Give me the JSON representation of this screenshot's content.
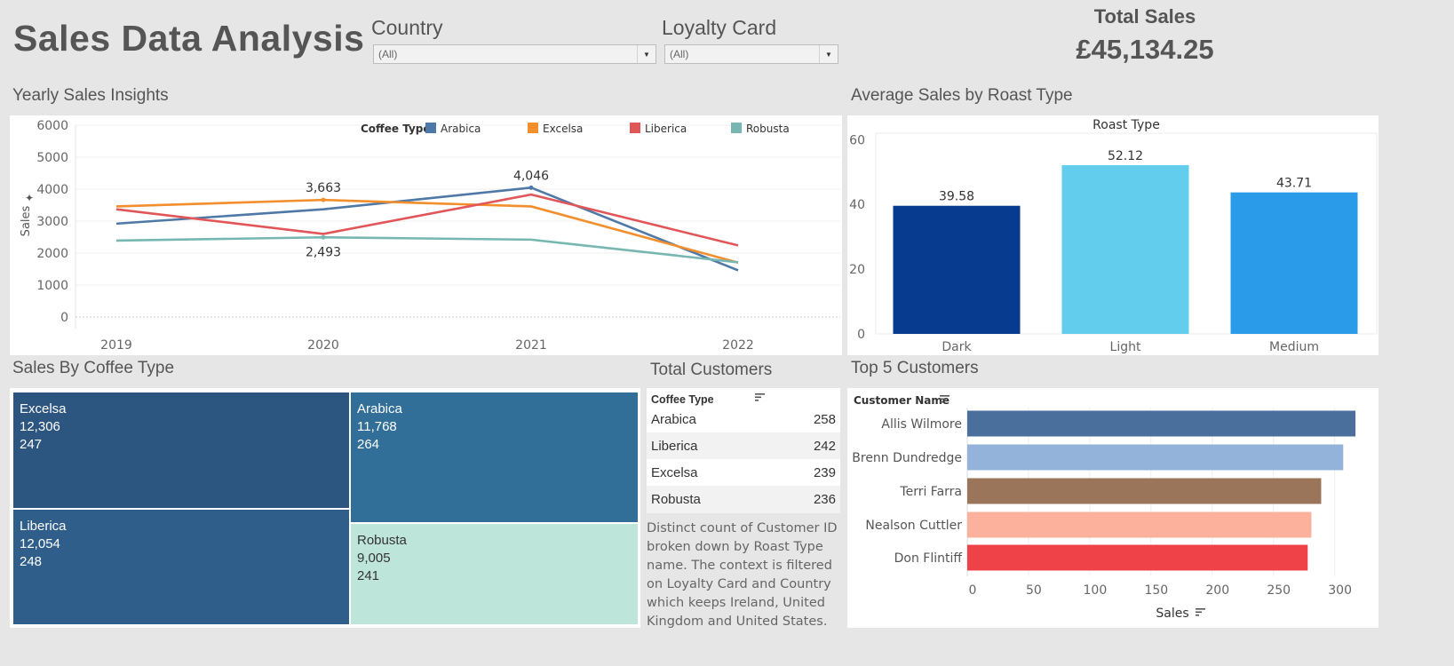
{
  "header": {
    "title": "Sales Data Analysis",
    "filters": [
      {
        "label": "Country",
        "value": "(All)"
      },
      {
        "label": "Loyalty Card",
        "value": "(All)"
      }
    ],
    "kpi": {
      "label": "Total Sales",
      "value": "£45,134.25"
    }
  },
  "sections": {
    "yearly": "Yearly Sales Insights",
    "roast": "Average Sales by Roast Type",
    "coffee": "Sales By Coffee Type",
    "customers": "Total Customers",
    "top5": "Top 5 Customers"
  },
  "colors": {
    "Arabica": "#4e79a7",
    "Excelsa": "#f28e2b",
    "Liberica": "#e15759",
    "Robusta": "#76b7b2"
  },
  "chart_data": [
    {
      "type": "line",
      "ylabel": "Sales",
      "legend_title": "Coffee Type",
      "x": [
        "2019",
        "2020",
        "2021",
        "2022"
      ],
      "ylim": [
        0,
        6000
      ],
      "yticks": [
        "0",
        "1000",
        "2000",
        "3000",
        "4000",
        "5000",
        "6000"
      ],
      "series": [
        {
          "name": "Arabica",
          "values": [
            2920,
            3370,
            4046,
            1460
          ]
        },
        {
          "name": "Excelsa",
          "values": [
            3460,
            3663,
            3460,
            1700
          ]
        },
        {
          "name": "Liberica",
          "values": [
            3370,
            2600,
            3830,
            2240
          ]
        },
        {
          "name": "Robusta",
          "values": [
            2390,
            2493,
            2420,
            1710
          ]
        }
      ],
      "annotations": [
        {
          "series": "Excelsa",
          "x": "2020",
          "text": "3,663"
        },
        {
          "series": "Robusta",
          "x": "2020",
          "text": "2,493"
        },
        {
          "series": "Arabica",
          "x": "2021",
          "text": "4,046"
        }
      ]
    },
    {
      "type": "bar",
      "title": "Roast Type",
      "categories": [
        "Dark",
        "Light",
        "Medium"
      ],
      "values": [
        39.58,
        52.12,
        43.71
      ],
      "labels": [
        "39.58",
        "52.12",
        "43.71"
      ],
      "colors": [
        "#063b8f",
        "#63cdee",
        "#2a9be9"
      ],
      "ylim": [
        0,
        62
      ],
      "yticks": [
        "0",
        "20",
        "40",
        "60"
      ]
    },
    {
      "type": "treemap",
      "cells": [
        {
          "name": "Excelsa",
          "sales": "12,306",
          "count": "247",
          "color": "#2c557f",
          "text": "#ffffff"
        },
        {
          "name": "Arabica",
          "sales": "11,768",
          "count": "264",
          "color": "#326f98",
          "text": "#ffffff"
        },
        {
          "name": "Liberica",
          "sales": "12,054",
          "count": "248",
          "color": "#2e5e89",
          "text": "#ffffff"
        },
        {
          "name": "Robusta",
          "sales": "9,005",
          "count": "241",
          "color": "#bee5da",
          "text": "#333333"
        }
      ]
    },
    {
      "type": "table",
      "header": "Coffee Type",
      "rows": [
        {
          "name": "Arabica",
          "value": "258"
        },
        {
          "name": "Liberica",
          "value": "242"
        },
        {
          "name": "Excelsa",
          "value": "239"
        },
        {
          "name": "Robusta",
          "value": "236"
        }
      ]
    },
    {
      "type": "bar",
      "orientation": "horizontal",
      "ylabel": "Customer Name",
      "xlabel": "Sales",
      "categories": [
        "Allis Wilmore",
        "Brenn Dundredge",
        "Terri Farra",
        "Nealson Cuttler",
        "Don Flintiff"
      ],
      "values": [
        317,
        307,
        289,
        281,
        278
      ],
      "colors": [
        "#4a6f9c",
        "#93b3da",
        "#9b7559",
        "#fbb19b",
        "#ee4148"
      ],
      "xlim": [
        0,
        330
      ],
      "xticks": [
        "0",
        "50",
        "100",
        "150",
        "200",
        "250",
        "300"
      ]
    }
  ],
  "table_note": "Distinct count of Customer ID broken down by Roast Type name. The context is filtered on Loyalty Card and Country which keeps Ireland, United Kingdom and United States."
}
